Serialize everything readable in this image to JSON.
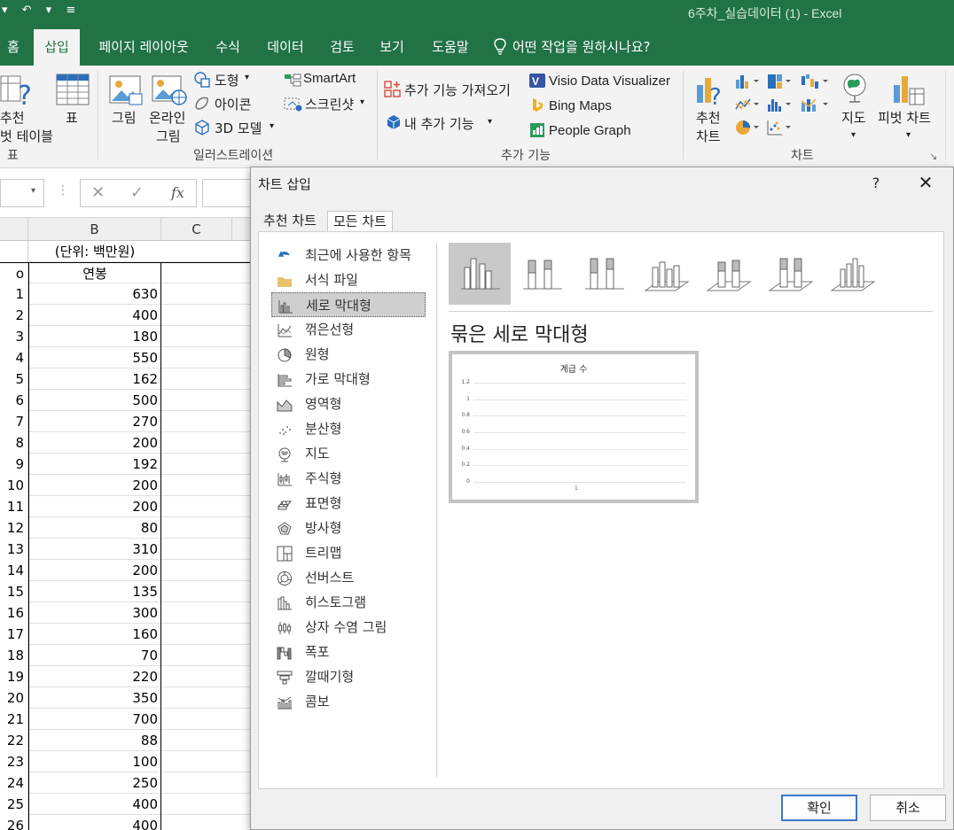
{
  "window": {
    "title": "6주차_실습데이터 (1)  -  Excel",
    "quick_access": "▾ ↶ ▾ ≡"
  },
  "tabs": [
    {
      "label": "홈"
    },
    {
      "label": "삽입"
    },
    {
      "label": "페이지 레이아웃"
    },
    {
      "label": "수식"
    },
    {
      "label": "데이터"
    },
    {
      "label": "검토"
    },
    {
      "label": "보기"
    },
    {
      "label": "도움말"
    },
    {
      "label": "어떤 작업을 원하시나요?"
    }
  ],
  "ribbon": {
    "tables": {
      "recommended_line1": "추천",
      "recommended_line2": "벗 테이블",
      "table": "표",
      "group": "표"
    },
    "illustrations": {
      "picture": "그림",
      "online_line1": "온라인",
      "online_line2": "그림",
      "shapes": "도형",
      "icons": "아이콘",
      "models3d": "3D 모델",
      "smartart": "SmartArt",
      "screenshot": "스크린샷",
      "group": "일러스트레이션"
    },
    "addins": {
      "get": "추가 기능 가져오기",
      "my": "내 추가 기능",
      "visio": "Visio Data Visualizer",
      "bing": "Bing Maps",
      "people": "People Graph",
      "group": "추가 기능"
    },
    "charts": {
      "recommended_line1": "추천",
      "recommended_line2": "차트",
      "maps": "지도",
      "pivot": "피벗 차트",
      "group": "차트"
    }
  },
  "formula_bar": {
    "fx": "fx",
    "cancel": "✕",
    "enter": "✓"
  },
  "sheet": {
    "columns": [
      "B",
      "C"
    ],
    "unit_note": "(단위: 백만원)",
    "header": "연봉",
    "header_row_stub": "o",
    "rows": [
      {
        "n": "1",
        "v": "630"
      },
      {
        "n": "2",
        "v": "400"
      },
      {
        "n": "3",
        "v": "180"
      },
      {
        "n": "4",
        "v": "550"
      },
      {
        "n": "5",
        "v": "162"
      },
      {
        "n": "6",
        "v": "500"
      },
      {
        "n": "7",
        "v": "270"
      },
      {
        "n": "8",
        "v": "200"
      },
      {
        "n": "9",
        "v": "192"
      },
      {
        "n": "10",
        "v": "200"
      },
      {
        "n": "11",
        "v": "200"
      },
      {
        "n": "12",
        "v": "80"
      },
      {
        "n": "13",
        "v": "310"
      },
      {
        "n": "14",
        "v": "200"
      },
      {
        "n": "15",
        "v": "135"
      },
      {
        "n": "16",
        "v": "300"
      },
      {
        "n": "17",
        "v": "160"
      },
      {
        "n": "18",
        "v": "70"
      },
      {
        "n": "19",
        "v": "220"
      },
      {
        "n": "20",
        "v": "350"
      },
      {
        "n": "21",
        "v": "700"
      },
      {
        "n": "22",
        "v": "88"
      },
      {
        "n": "23",
        "v": "100"
      },
      {
        "n": "24",
        "v": "250"
      },
      {
        "n": "25",
        "v": "400"
      },
      {
        "n": "26",
        "v": "400"
      }
    ]
  },
  "dialog": {
    "title": "차트 삽입",
    "help": "?",
    "close": "✕",
    "tabs": [
      "추천 차트",
      "모든 차트"
    ],
    "active_tab": 1,
    "chart_types": [
      {
        "label": "최근에 사용한 항목",
        "icon": "recent-icon"
      },
      {
        "label": "서식 파일",
        "icon": "folder-icon"
      },
      {
        "label": "세로 막대형",
        "icon": "column-chart-icon"
      },
      {
        "label": "꺾은선형",
        "icon": "line-chart-icon"
      },
      {
        "label": "원형",
        "icon": "pie-chart-icon"
      },
      {
        "label": "가로 막대형",
        "icon": "bar-chart-icon"
      },
      {
        "label": "영역형",
        "icon": "area-chart-icon"
      },
      {
        "label": "분산형",
        "icon": "scatter-chart-icon"
      },
      {
        "label": "지도",
        "icon": "map-chart-icon"
      },
      {
        "label": "주식형",
        "icon": "stock-chart-icon"
      },
      {
        "label": "표면형",
        "icon": "surface-chart-icon"
      },
      {
        "label": "방사형",
        "icon": "radar-chart-icon"
      },
      {
        "label": "트리맵",
        "icon": "treemap-chart-icon"
      },
      {
        "label": "선버스트",
        "icon": "sunburst-chart-icon"
      },
      {
        "label": "히스토그램",
        "icon": "histogram-chart-icon"
      },
      {
        "label": "상자 수염 그림",
        "icon": "boxwhisker-chart-icon"
      },
      {
        "label": "폭포",
        "icon": "waterfall-chart-icon"
      },
      {
        "label": "깔때기형",
        "icon": "funnel-chart-icon"
      },
      {
        "label": "콤보",
        "icon": "combo-chart-icon"
      }
    ],
    "selected_type": 2,
    "subtype_title": "묶은 세로 막대형",
    "selected_subtype": 0,
    "preview": {
      "title": "계급 수",
      "y_ticks": [
        "1.2",
        "1",
        "0.8",
        "0.6",
        "0.4",
        "0.2",
        "0"
      ],
      "x_label": "1"
    },
    "ok": "확인",
    "cancel": "취소"
  }
}
